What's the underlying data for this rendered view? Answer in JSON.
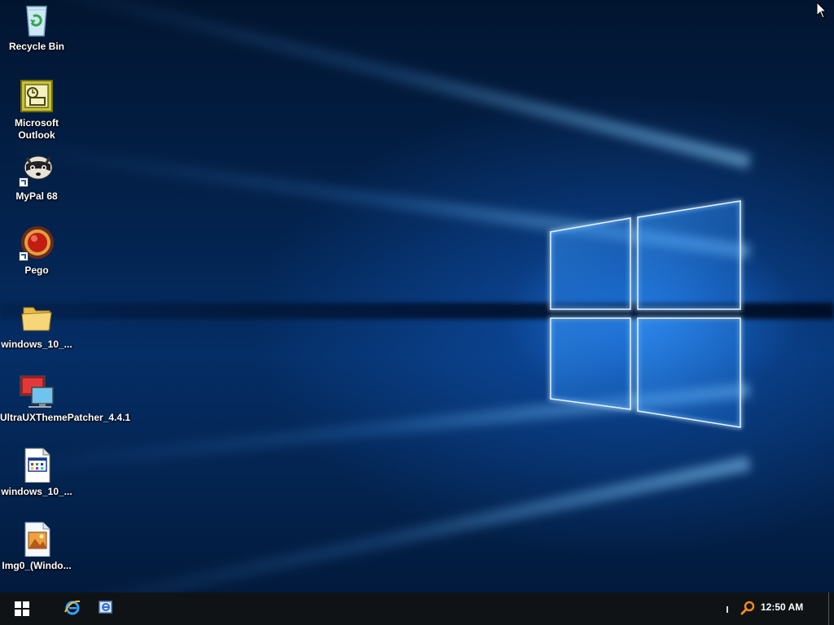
{
  "desktop": {
    "icons": [
      {
        "name": "recycle-bin",
        "label": "Recycle Bin",
        "icon": "recycle-bin-icon"
      },
      {
        "name": "microsoft-outlook",
        "label": "Microsoft Outlook",
        "icon": "outlook-icon"
      },
      {
        "name": "mypal-68",
        "label": "MyPal 68",
        "icon": "mypal-raccoon-icon"
      },
      {
        "name": "pego",
        "label": "Pego",
        "icon": "pego-icon"
      },
      {
        "name": "windows-10-folder",
        "label": "windows_10_...",
        "icon": "folder-icon"
      },
      {
        "name": "ultrauxthemepatcher",
        "label": "UltraUXThemePatcher_4.4.1",
        "icon": "monitor-icon"
      },
      {
        "name": "windows-10-file",
        "label": "windows_10_...",
        "icon": "application-file-icon"
      },
      {
        "name": "img0-file",
        "label": "Img0_(Windo...",
        "icon": "image-file-icon"
      }
    ]
  },
  "taskbar": {
    "start_icon": "windows-logo-icon",
    "pinned": [
      {
        "name": "internet-explorer",
        "icon": "internet-explorer-icon"
      },
      {
        "name": "pinned-app",
        "icon": "app-window-icon"
      }
    ],
    "tray": {
      "search_icon": "search-icon",
      "time": "12:50 AM"
    }
  },
  "colors": {
    "taskbar_bg": "#101316",
    "wallpaper_blue": "#052e66",
    "logo_glow": "#5ab4ff"
  }
}
